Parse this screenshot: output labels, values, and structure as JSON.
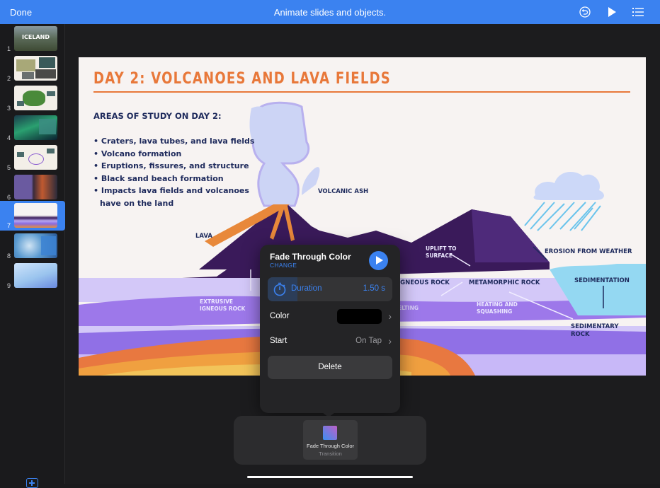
{
  "topbar": {
    "done_label": "Done",
    "title": "Animate slides and objects.",
    "icons": [
      "undo-icon",
      "play-icon",
      "list-icon"
    ],
    "accent_color": "#3b82f0"
  },
  "sidebar": {
    "slides": [
      {
        "number": "1",
        "label": "ICELAND"
      },
      {
        "number": "2"
      },
      {
        "number": "3"
      },
      {
        "number": "4"
      },
      {
        "number": "5"
      },
      {
        "number": "6"
      },
      {
        "number": "7",
        "selected": true
      },
      {
        "number": "8"
      },
      {
        "number": "9"
      }
    ],
    "add_icon": "add-slide-icon"
  },
  "slide": {
    "title": "DAY 2: VOLCANOES AND LAVA FIELDS",
    "subtitle": "AREAS OF STUDY ON DAY 2:",
    "bullets": [
      "Craters, lava tubes, and lava fields",
      "Volcano formation",
      "Eruptions, fissures, and structure",
      "Black sand beach formation",
      "Impacts lava fields and volcanoes have on the land"
    ],
    "labels": {
      "volcanic_ash": "VOLCANIC ASH",
      "lava": "LAVA",
      "extrusive_1": "EXTRUSIVE",
      "extrusive_2": "IGNEOUS ROCK",
      "uplift_1": "UPLIFT TO",
      "uplift_2": "SURFACE",
      "igneous": "IGNEOUS ROCK",
      "metamorphic": "METAMORPHIC ROCK",
      "melting": "ELTING",
      "heating_1": "HEATING AND",
      "heating_2": "SQUASHING",
      "erosion": "EROSION FROM WEATHER",
      "sedimentation": "SEDIMENTATION",
      "sedimentary_1": "SEDIMENTARY",
      "sedimentary_2": "ROCK"
    }
  },
  "popover": {
    "title": "Fade Through Color",
    "change_label": "CHANGE",
    "duration_label": "Duration",
    "duration_value": "1.50 s",
    "duration_fill_fraction": 0.24,
    "color_label": "Color",
    "color_value": "#000000",
    "start_label": "Start",
    "start_value": "On Tap",
    "delete_label": "Delete"
  },
  "tray": {
    "item_name": "Fade Through Color",
    "item_type": "Transition"
  }
}
